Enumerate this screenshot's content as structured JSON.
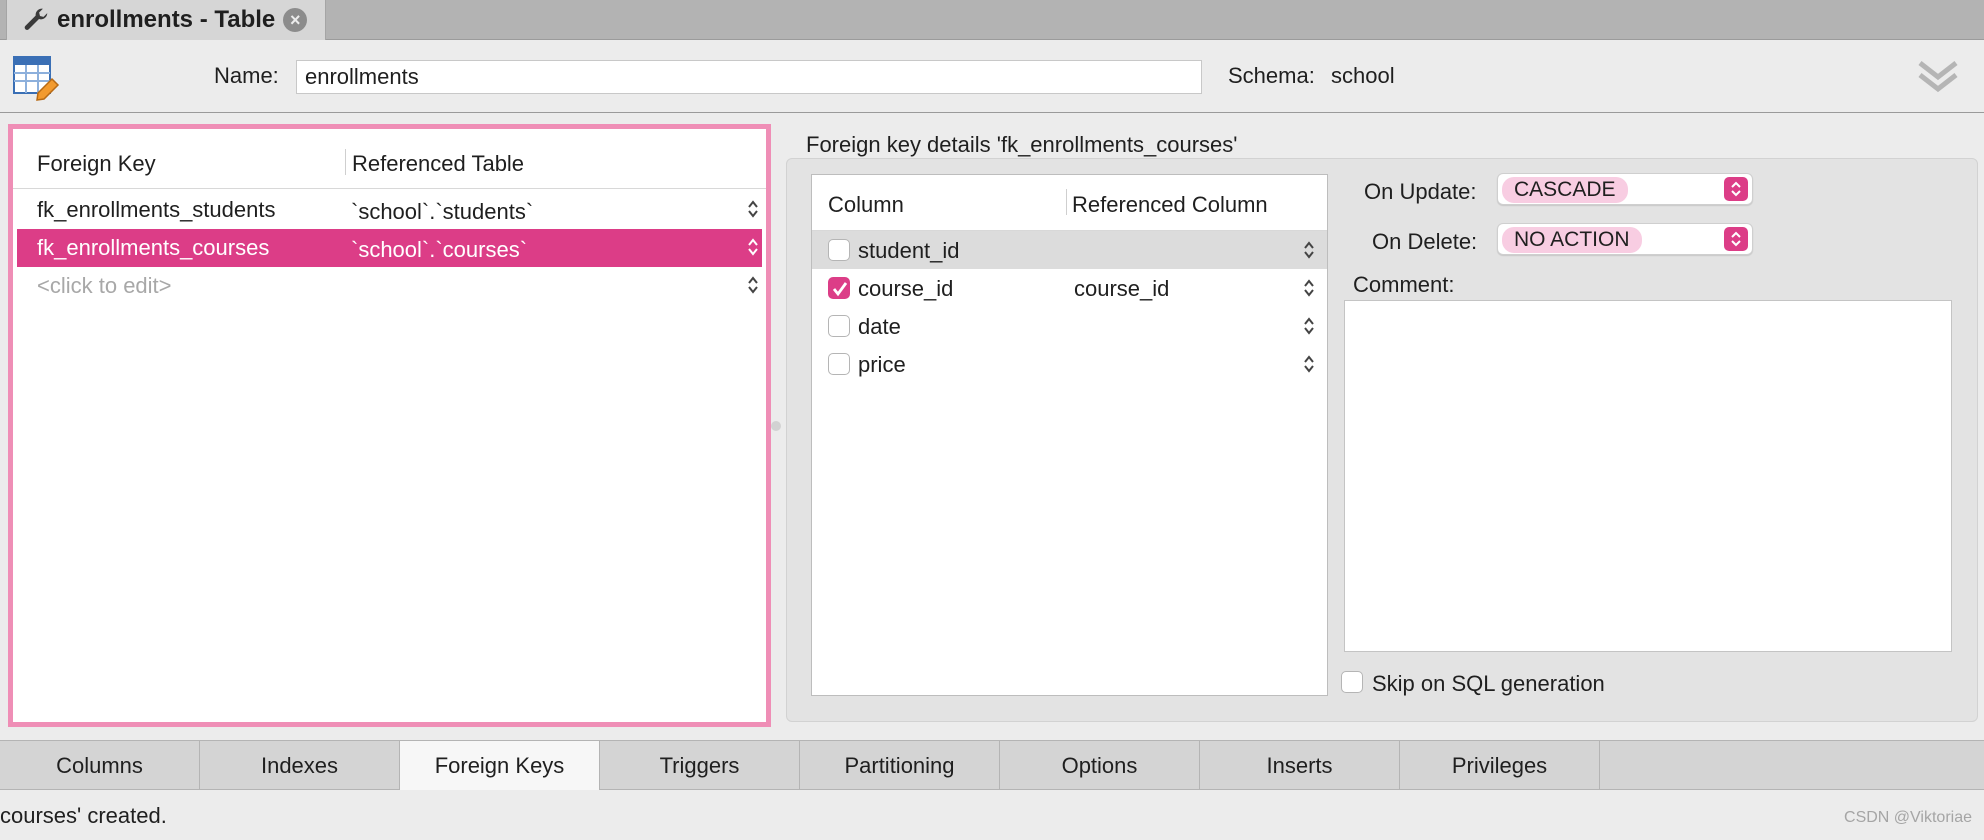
{
  "window_tab": {
    "title": "enrollments - Table",
    "close_symbol": "×"
  },
  "header": {
    "name_label": "Name:",
    "name_value": "enrollments",
    "schema_label": "Schema:",
    "schema_value": "school"
  },
  "foreign_keys": {
    "headers": [
      "Foreign Key",
      "Referenced Table"
    ],
    "rows": [
      {
        "name": "fk_enrollments_students",
        "table": "`school`.`students`"
      },
      {
        "name": "fk_enrollments_courses",
        "table": "`school`.`courses`"
      },
      {
        "name": "<click to edit>",
        "table": ""
      }
    ],
    "selected_index": 1
  },
  "details": {
    "title": "Foreign key details 'fk_enrollments_courses'",
    "column_headers": [
      "Column",
      "Referenced Column"
    ],
    "columns": [
      {
        "name": "student_id",
        "checked": false,
        "ref": ""
      },
      {
        "name": "course_id",
        "checked": true,
        "ref": "course_id"
      },
      {
        "name": "date",
        "checked": false,
        "ref": ""
      },
      {
        "name": "price",
        "checked": false,
        "ref": ""
      }
    ],
    "on_update_label": "On Update:",
    "on_update_value": "CASCADE",
    "on_delete_label": "On Delete:",
    "on_delete_value": "NO ACTION",
    "comment_label": "Comment:",
    "comment_value": "",
    "skip_label": "Skip on SQL generation",
    "skip_checked": false
  },
  "bottom_tabs": {
    "items": [
      "Columns",
      "Indexes",
      "Foreign Keys",
      "Triggers",
      "Partitioning",
      "Options",
      "Inserts",
      "Privileges"
    ],
    "active": "Foreign Keys"
  },
  "status": {
    "text": "courses' created."
  },
  "watermark": "CSDN @Viktoriae",
  "colors": {
    "accent": "#dc3d87",
    "accent_light": "#f8cde2",
    "panel_border": "#ef8eb6"
  },
  "icons": [
    "wrench-icon",
    "close-icon",
    "table-edit-icon",
    "collapse-chevrons-icon",
    "updown-arrows-icon",
    "checkmark-icon"
  ]
}
